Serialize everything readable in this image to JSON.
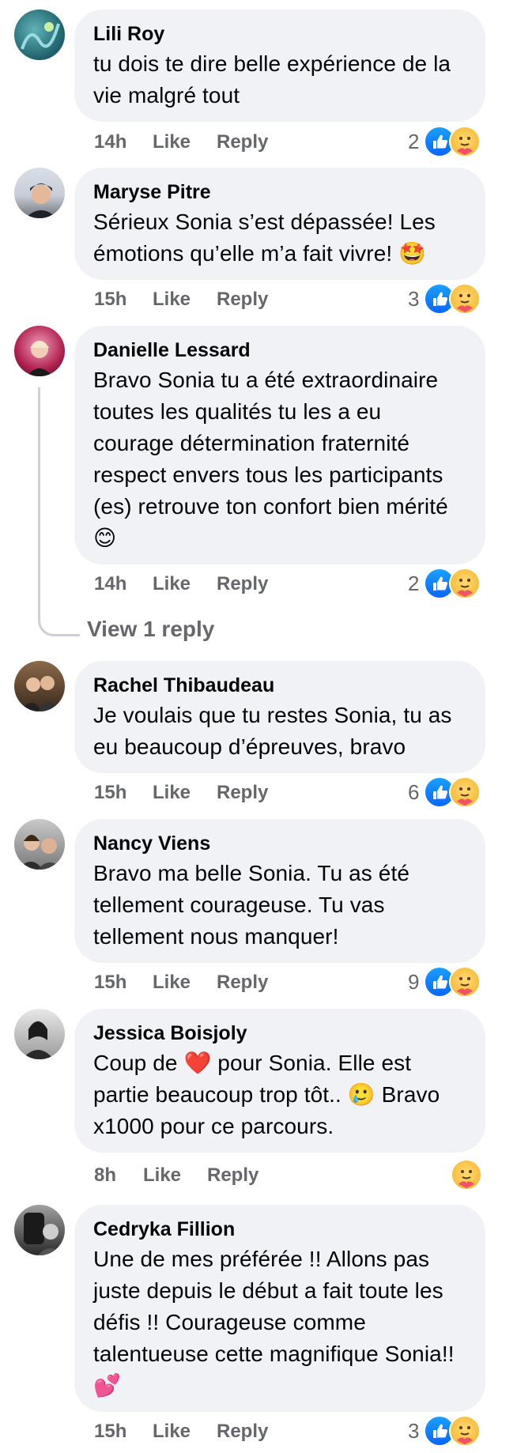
{
  "comments": [
    {
      "author": "Lili Roy",
      "text": "tu dois te dire belle expérience de la vie malgré tout",
      "time": "14h",
      "like": "Like",
      "reply": "Reply",
      "count": "2",
      "reactions": [
        "like-icon",
        "care-icon"
      ]
    },
    {
      "author": "Maryse Pitre",
      "text": "Sérieux Sonia s’est dépassée! Les émotions qu’elle m’a fait vivre! 🤩",
      "time": "15h",
      "like": "Like",
      "reply": "Reply",
      "count": "3",
      "reactions": [
        "like-icon",
        "care-icon"
      ]
    },
    {
      "author": "Danielle Lessard",
      "text": "Bravo Sonia tu a été extraordinaire toutes les qualités tu les a eu courage détermination fraternité respect envers tous les participants (es) retrouve ton confort bien mérité 😊",
      "time": "14h",
      "like": "Like",
      "reply": "Reply",
      "count": "2",
      "reactions": [
        "like-icon",
        "care-icon"
      ]
    },
    {
      "author": "Rachel Thibaudeau",
      "text": "Je voulais que tu restes Sonia, tu as eu beaucoup d’épreuves, bravo",
      "time": "15h",
      "like": "Like",
      "reply": "Reply",
      "count": "6",
      "reactions": [
        "like-icon",
        "care-icon"
      ]
    },
    {
      "author": "Nancy Viens",
      "text": "Bravo ma belle Sonia. Tu as été tellement courageuse. Tu vas tellement nous manquer!",
      "time": "15h",
      "like": "Like",
      "reply": "Reply",
      "count": "9",
      "reactions": [
        "like-icon",
        "care-icon"
      ]
    },
    {
      "author": "Jessica Boisjoly",
      "text": "Coup de ❤️ pour Sonia. Elle est partie beaucoup trop tôt.. 🥲 Bravo x1000 pour ce parcours.",
      "time": "8h",
      "like": "Like",
      "reply": "Reply",
      "count": "",
      "reactions": [
        "care-icon"
      ]
    },
    {
      "author": "Cedryka Fillion",
      "text": "Une de mes préférée !! Allons pas juste depuis le début a fait toute les défis !! Courageuse comme talentueuse cette magnifique Sonia!!💕",
      "time": "15h",
      "like": "Like",
      "reply": "Reply",
      "count": "3",
      "reactions": [
        "like-icon",
        "care-icon"
      ]
    }
  ],
  "thread": {
    "view_reply": "View 1 reply"
  },
  "colors": {
    "bubble": "#f0f2f5",
    "meta_text": "#65676b",
    "like_blue": "#0866ff",
    "care_yellow": "#f7b125"
  }
}
